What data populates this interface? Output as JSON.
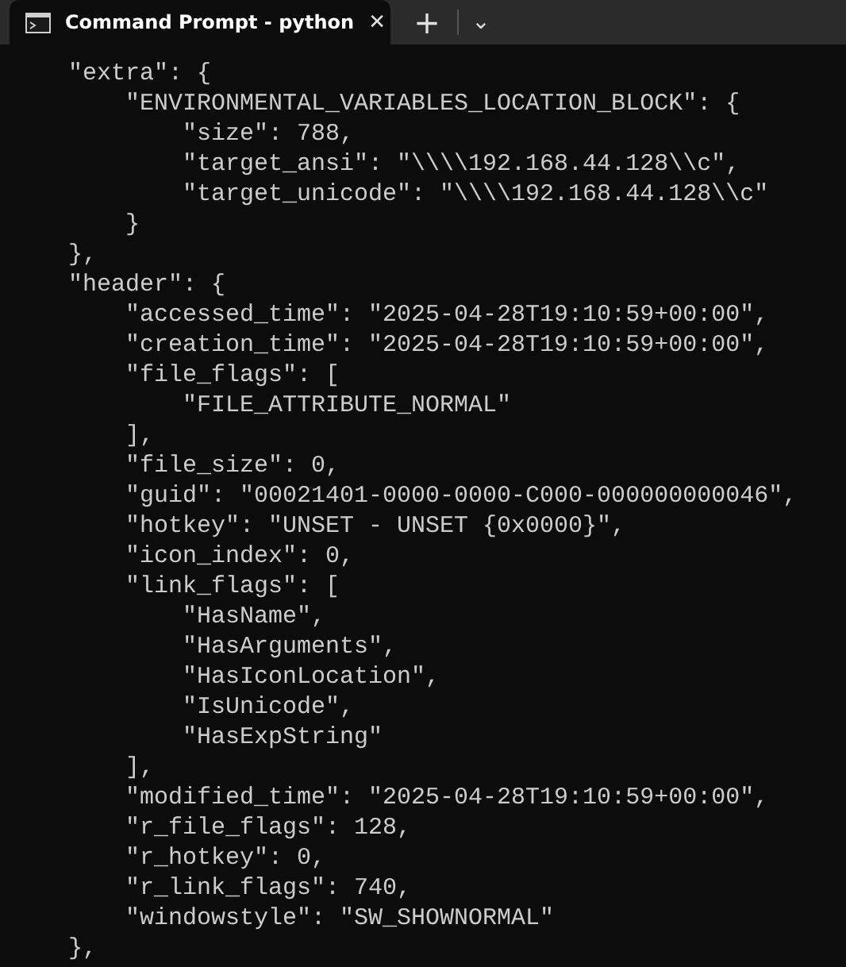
{
  "tabs": [
    {
      "title": "Command Prompt - python",
      "close": "✕",
      "selected": true
    }
  ],
  "new_tab": "+",
  "dropdown": "⌄",
  "terminal_lines": [
    "    \"extra\": {",
    "        \"ENVIRONMENTAL_VARIABLES_LOCATION_BLOCK\": {",
    "            \"size\": 788,",
    "            \"target_ansi\": \"\\\\\\\\192.168.44.128\\\\c\",",
    "            \"target_unicode\": \"\\\\\\\\192.168.44.128\\\\c\"",
    "        }",
    "    },",
    "    \"header\": {",
    "        \"accessed_time\": \"2025-04-28T19:10:59+00:00\",",
    "        \"creation_time\": \"2025-04-28T19:10:59+00:00\",",
    "        \"file_flags\": [",
    "            \"FILE_ATTRIBUTE_NORMAL\"",
    "        ],",
    "        \"file_size\": 0,",
    "        \"guid\": \"00021401-0000-0000-C000-000000000046\",",
    "        \"hotkey\": \"UNSET - UNSET {0x0000}\",",
    "        \"icon_index\": 0,",
    "        \"link_flags\": [",
    "            \"HasName\",",
    "            \"HasArguments\",",
    "            \"HasIconLocation\",",
    "            \"IsUnicode\",",
    "            \"HasExpString\"",
    "        ],",
    "        \"modified_time\": \"2025-04-28T19:10:59+00:00\",",
    "        \"r_file_flags\": 128,",
    "        \"r_hotkey\": 0,",
    "        \"r_link_flags\": 740,",
    "        \"windowstyle\": \"SW_SHOWNORMAL\"",
    "    },"
  ]
}
